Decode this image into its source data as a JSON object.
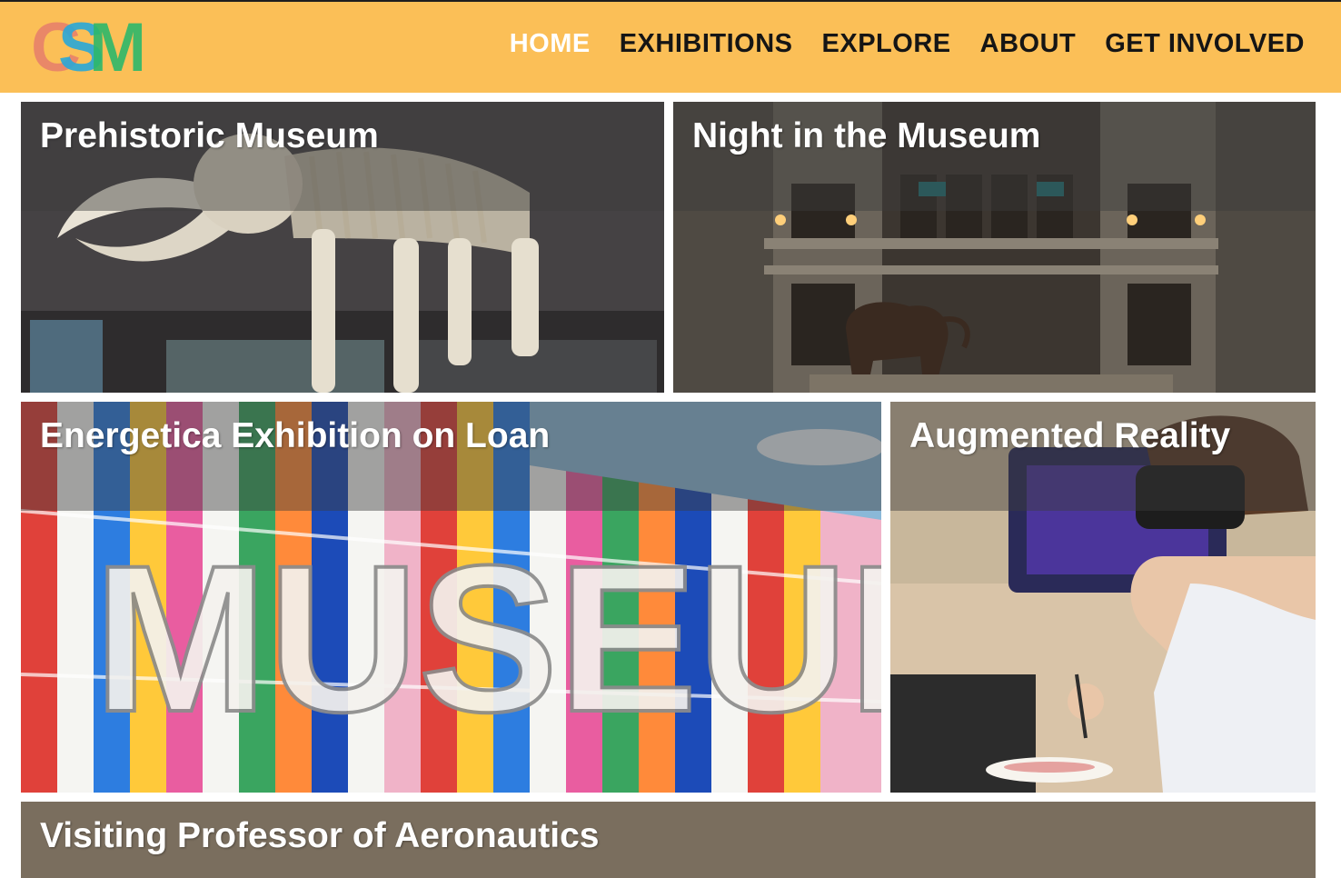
{
  "header": {
    "logo_text": "CSM",
    "background_color": "#fbbf57",
    "nav": [
      {
        "label": "HOME",
        "active": true
      },
      {
        "label": "EXHIBITIONS",
        "active": false
      },
      {
        "label": "EXPLORE",
        "active": false
      },
      {
        "label": "ABOUT",
        "active": false
      },
      {
        "label": "GET INVOLVED",
        "active": false
      }
    ]
  },
  "cards": [
    {
      "title": "Prehistoric Museum",
      "image": "mammoth-skeleton"
    },
    {
      "title": "Night in the Museum",
      "image": "museum-rotunda-elephant"
    },
    {
      "title": "Energetica Exhibition on Loan",
      "image": "colorful-museum-facade"
    },
    {
      "title": "Augmented Reality",
      "image": "vr-headset-visitor"
    },
    {
      "title": "Visiting Professor of Aeronautics",
      "image": "aeronautics"
    }
  ],
  "museum_sign_text": "MUSEUM"
}
